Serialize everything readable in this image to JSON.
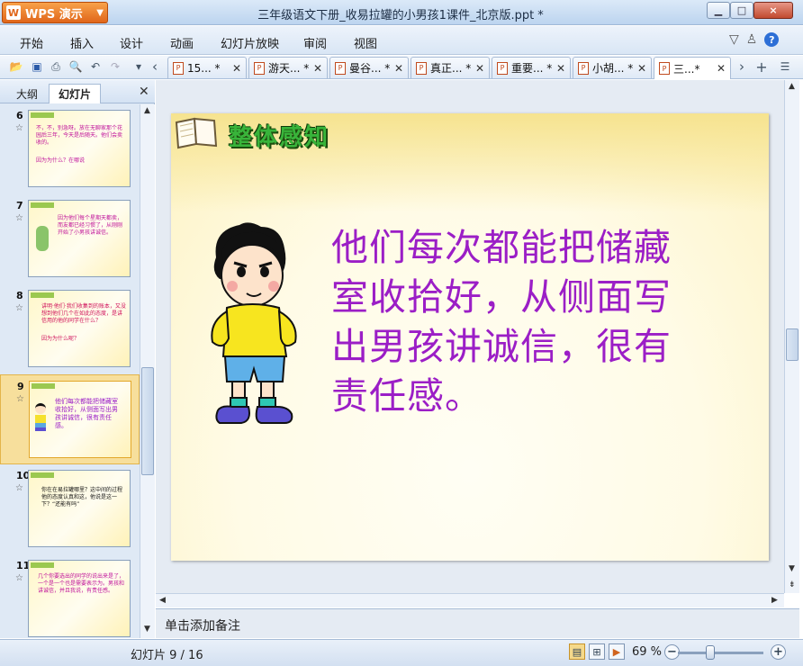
{
  "app": {
    "name": "WPS 演示",
    "window_title": "三年级语文下册_收易拉罐的小男孩1课件_北京版.ppt *"
  },
  "menu": [
    "开始",
    "插入",
    "设计",
    "动画",
    "幻灯片放映",
    "审阅",
    "视图"
  ],
  "doc_tabs": [
    {
      "label": "15... *"
    },
    {
      "label": "游天... *"
    },
    {
      "label": "曼谷... *"
    },
    {
      "label": "真正... *"
    },
    {
      "label": "重要... *"
    },
    {
      "label": "小胡... *"
    },
    {
      "label": "三...*",
      "active": true
    }
  ],
  "panel": {
    "outline_tab": "大纲",
    "slides_tab": "幻灯片"
  },
  "thumbnails": [
    {
      "num": "6",
      "text": "不，不，别急呀。放在无聊家那个花园后三年，今天是后随天。他们会卖收的。",
      "text2": "因为为什么？在哪说"
    },
    {
      "num": "7",
      "text": "因为他们每个星期天都卖，而友都已经习惯了，从刚刚开始了小男孩讲诚信。"
    },
    {
      "num": "8",
      "text": "讲明·他们·我们收集到的账本，又没想到他们几个在如此的态度，是讲信用的他的同学在什么？",
      "text2": "因为为什么呢？"
    },
    {
      "num": "9",
      "text": "他们每次都能把储藏室收拾好，从侧面写出男孩讲诚信，很有责任感。",
      "selected": true
    },
    {
      "num": "10",
      "text": "你在在易拉罐哪里？这中间的过程他的态度认真和这，他说是这一下？“还能有吗”"
    },
    {
      "num": "11",
      "text": "几个你要选出的同学的说出来是了，一个是一个也是需要表示为。男孩和讲诚信，并且我说，有责任感。"
    }
  ],
  "slide": {
    "heading": "整体感知",
    "body": "他们每次都能把储藏室收拾好，从侧面写出男孩讲诚信，很有责任感。"
  },
  "notes_placeholder": "单击添加备注",
  "status": {
    "slide_counter": "幻灯片 9 / 16",
    "zoom": "69 %"
  },
  "icons": {
    "help": "?",
    "close": "×",
    "minimize": "▁",
    "maximize": "□"
  }
}
